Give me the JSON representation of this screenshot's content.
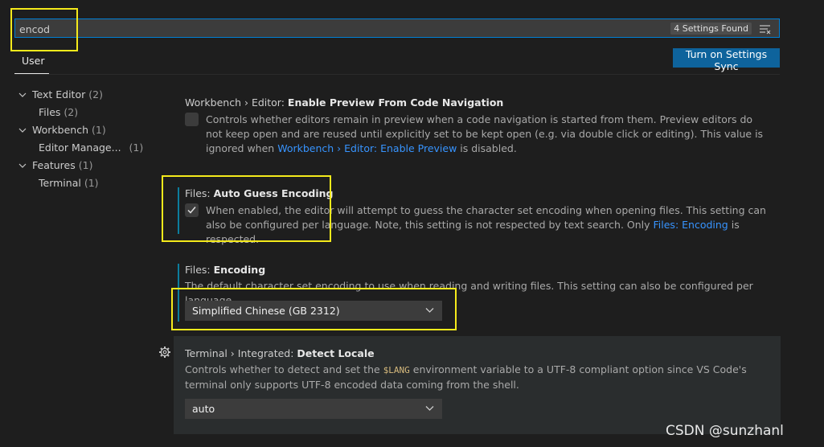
{
  "search": {
    "value": "encod",
    "found_badge": "4 Settings Found",
    "filter_icon": "clear-filter-icon"
  },
  "tabs": [
    {
      "label": "User",
      "active": true
    }
  ],
  "sync_button": {
    "label": "Turn on Settings Sync",
    "color": "#0e639c"
  },
  "toc": [
    {
      "label": "Text Editor",
      "count": "(2)",
      "level": 0,
      "expanded": true
    },
    {
      "label": "Files",
      "count": "(2)",
      "level": 1
    },
    {
      "label": "Workbench",
      "count": "(1)",
      "level": 0,
      "expanded": true
    },
    {
      "label": "Editor Manage...",
      "count": "(1)",
      "level": 1
    },
    {
      "label": "Features",
      "count": "(1)",
      "level": 0,
      "expanded": true
    },
    {
      "label": "Terminal",
      "count": "(1)",
      "level": 1
    }
  ],
  "settings": {
    "preview": {
      "category": "Workbench › Editor: ",
      "name": "Enable Preview From Code Navigation",
      "desc_before": "Controls whether editors remain in preview when a code navigation is started from them. Preview editors do not keep open and are reused until explicitly set to be kept open (e.g. via double click or editing). This value is ignored when ",
      "desc_link": "Workbench › Editor: Enable Preview",
      "desc_after": " is disabled.",
      "checked": false
    },
    "auto_guess": {
      "category": "Files: ",
      "name": "Auto Guess Encoding",
      "desc_before": "When enabled, the editor will attempt to guess the character set encoding when opening files. This setting can also be configured per language. Note, this setting is not respected by text search. Only ",
      "desc_link": "Files: Encoding",
      "desc_after": " is respected.",
      "checked": true
    },
    "encoding": {
      "category": "Files: ",
      "name": "Encoding",
      "desc": "The default character set encoding to use when reading and writing files. This setting can also be configured per language.",
      "value": "Simplified Chinese (GB 2312)"
    },
    "locale": {
      "category": "Terminal › Integrated: ",
      "name": "Detect Locale",
      "desc_before": "Controls whether to detect and set the ",
      "desc_code": "$LANG",
      "desc_after": " environment variable to a UTF-8 compliant option since VS Code's terminal only supports UTF-8 encoded data coming from the shell.",
      "value": "auto"
    }
  },
  "watermark": "CSDN @sunzhanl",
  "colors": {
    "background": "#1e1e1e",
    "accent": "#007fd4",
    "link": "#3794ff",
    "highlight_box": "#f5ea1b",
    "modified_bar": "#0c7d9d"
  }
}
